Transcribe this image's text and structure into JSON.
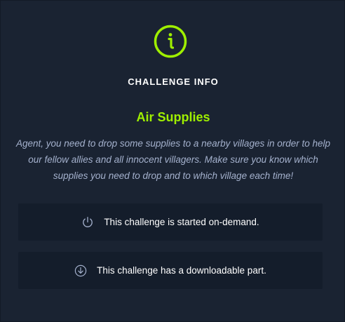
{
  "header": {
    "icon": "info-circle-icon",
    "heading": "CHALLENGE INFO"
  },
  "challenge": {
    "title": "Air Supplies",
    "description": "Agent, you need to drop some supplies to a nearby villages in order to help our fellow allies and all innocent villagers. Make sure you know which supplies you need to drop and to which village each time!"
  },
  "features": [
    {
      "icon": "power-icon",
      "label": "This challenge is started on-demand."
    },
    {
      "icon": "download-icon",
      "label": "This challenge has a downloadable part."
    }
  ],
  "colors": {
    "background": "#1a2332",
    "row_background": "#141d2b",
    "accent": "#9fef00",
    "description_text": "#a4b1cd"
  }
}
